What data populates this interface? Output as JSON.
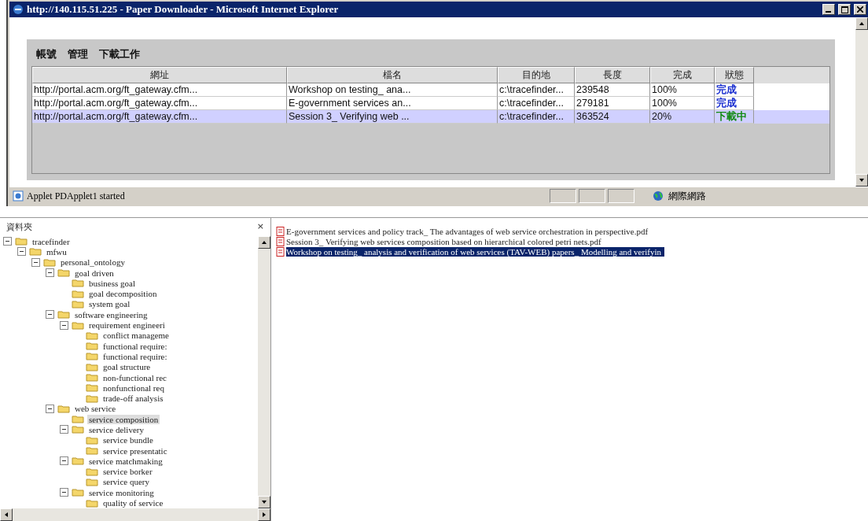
{
  "window": {
    "title": "http://140.115.51.225 - Paper Downloader - Microsoft Internet Explorer"
  },
  "menu": [
    "帳號",
    "管理",
    "下載工作"
  ],
  "table": {
    "columns": [
      "網址",
      "檔名",
      "目的地",
      "長度",
      "完成",
      "狀態"
    ],
    "rows": [
      {
        "selected": false,
        "cells": [
          "http://portal.acm.org/ft_gateway.cfm...",
          "Workshop on testing_ ana...",
          "c:\\tracefinder...",
          "239548",
          "100%"
        ],
        "status": {
          "text": "完成",
          "color": "#1a2fd0"
        }
      },
      {
        "selected": false,
        "cells": [
          "http://portal.acm.org/ft_gateway.cfm...",
          "E-government services an...",
          "c:\\tracefinder...",
          "279181",
          "100%"
        ],
        "status": {
          "text": "完成",
          "color": "#1a2fd0"
        }
      },
      {
        "selected": true,
        "cells": [
          "http://portal.acm.org/ft_gateway.cfm...",
          "Session 3_ Verifying web ...",
          "c:\\tracefinder...",
          "363524",
          "20%"
        ],
        "status": {
          "text": "下載中",
          "color": "#118a11"
        }
      }
    ]
  },
  "status_bar": {
    "message": "Applet PDApplet1 started",
    "zone": "網際網路"
  },
  "folder_pane": {
    "title": "資料夾",
    "close": "×",
    "tree": [
      {
        "label": "tracefinder",
        "expanded": true,
        "selected": false,
        "children": [
          {
            "label": "mfwu",
            "expanded": true,
            "selected": false,
            "children": [
              {
                "label": "personal_ontology",
                "expanded": true,
                "selected": false,
                "children": [
                  {
                    "label": "goal driven",
                    "expanded": true,
                    "selected": false,
                    "children": [
                      {
                        "label": "business goal",
                        "selected": false
                      },
                      {
                        "label": "goal decomposition",
                        "selected": false
                      },
                      {
                        "label": "system goal",
                        "selected": false
                      }
                    ]
                  },
                  {
                    "label": "software engineering",
                    "expanded": true,
                    "selected": false,
                    "children": [
                      {
                        "label": "requirement engineeri",
                        "expanded": true,
                        "selected": false,
                        "children": [
                          {
                            "label": "conflict manageme",
                            "selected": false
                          },
                          {
                            "label": "functional require:",
                            "selected": false
                          },
                          {
                            "label": "functional require:",
                            "selected": false
                          },
                          {
                            "label": "goal structure",
                            "selected": false
                          },
                          {
                            "label": "non-functional rec",
                            "selected": false
                          },
                          {
                            "label": "nonfunctional req",
                            "selected": false
                          },
                          {
                            "label": "trade-off analysis",
                            "selected": false
                          }
                        ]
                      }
                    ]
                  },
                  {
                    "label": "web service",
                    "expanded": true,
                    "selected": false,
                    "children": [
                      {
                        "label": "service composition",
                        "selected": true
                      },
                      {
                        "label": "service delivery",
                        "expanded": true,
                        "selected": false,
                        "children": [
                          {
                            "label": "service bundle",
                            "selected": false
                          },
                          {
                            "label": "service presentatic",
                            "selected": false
                          }
                        ]
                      },
                      {
                        "label": "service matchmaking",
                        "expanded": true,
                        "selected": false,
                        "children": [
                          {
                            "label": "service borker",
                            "selected": false
                          },
                          {
                            "label": "service query",
                            "selected": false
                          }
                        ]
                      },
                      {
                        "label": "service monitoring",
                        "expanded": true,
                        "selected": false,
                        "children": [
                          {
                            "label": "quality of service",
                            "selected": false
                          }
                        ]
                      }
                    ]
                  }
                ]
              }
            ]
          }
        ]
      }
    ]
  },
  "files": [
    {
      "name": "E-government services and policy track_ The advantages of web service orchestration in perspective.pdf",
      "selected": false
    },
    {
      "name": "Session 3_ Verifying web services composition based on hierarchical colored petri nets.pdf",
      "selected": false
    },
    {
      "name": "Workshop on testing_ analysis and verification of web services (TAV-WEB) papers_ Modelling and verifyin",
      "selected": true
    }
  ]
}
